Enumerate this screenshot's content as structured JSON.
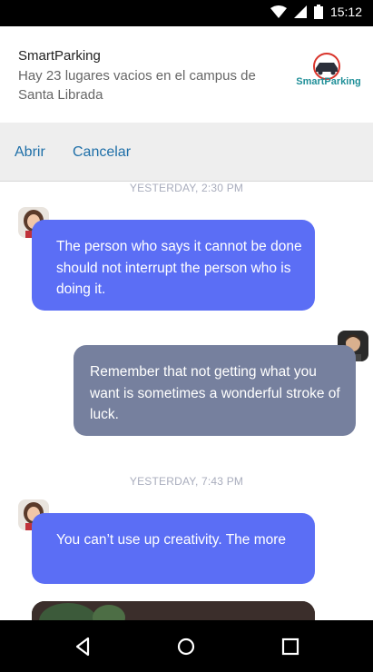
{
  "status_bar": {
    "time": "15:12"
  },
  "notification": {
    "app_name": "SmartParking",
    "message": "Hay 23 lugares vacios en el campus de Santa Librada",
    "logo_text": "SmartParking",
    "actions": {
      "open": "Abrir",
      "cancel": "Cancelar"
    }
  },
  "chat": {
    "timestamps": [
      "YESTERDAY, 2:30 PM",
      "YESTERDAY, 7:43 PM"
    ],
    "messages": [
      {
        "text": "The person who says it cannot be done should not interrupt the person who is doing it."
      },
      {
        "text": "Remember that not getting what you want is sometimes a wonderful stroke of luck."
      },
      {
        "text": "You can’t use up creativity. The more"
      }
    ]
  },
  "colors": {
    "incoming": "#5b6ef5",
    "outgoing": "#76809e",
    "action": "#1e6fa8"
  }
}
